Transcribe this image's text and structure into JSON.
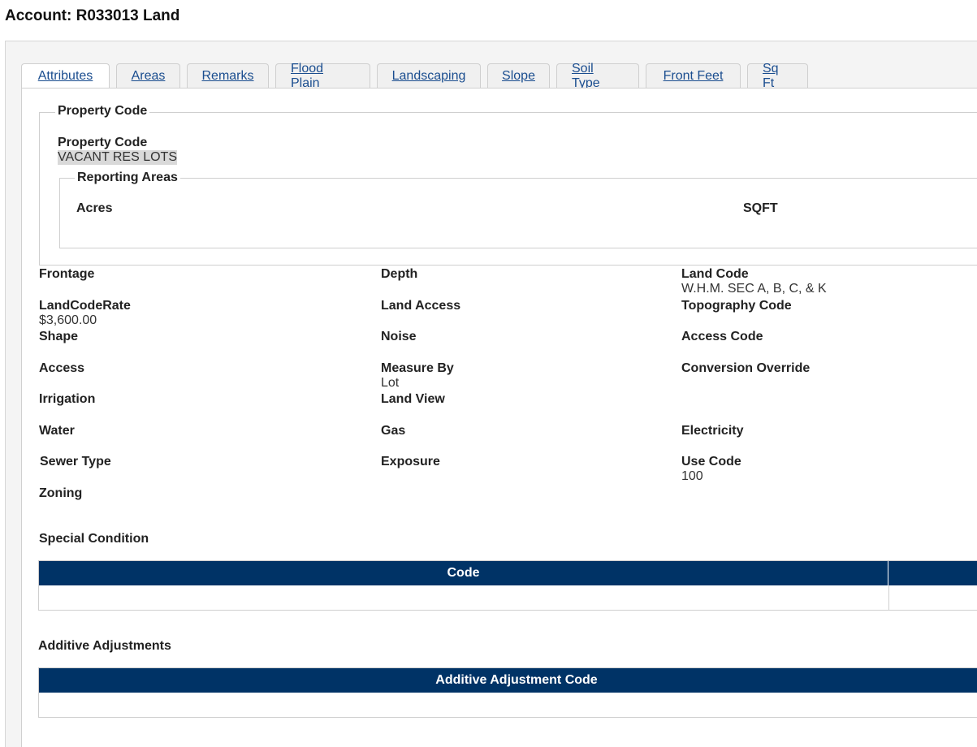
{
  "page": {
    "title": "Account: R033013 Land"
  },
  "tabs": [
    {
      "label": "Attributes",
      "active": true
    },
    {
      "label": "Areas",
      "active": false
    },
    {
      "label": "Remarks",
      "active": false
    },
    {
      "label": "Flood Plain",
      "active": false
    },
    {
      "label": "Landscaping",
      "active": false
    },
    {
      "label": "Slope",
      "active": false
    },
    {
      "label": "Soil Type",
      "active": false
    },
    {
      "label": "Front Feet",
      "active": false
    },
    {
      "label": "Sq Ft",
      "active": false
    }
  ],
  "property_code": {
    "legend": "Property Code",
    "label": "Property Code",
    "value": "VACANT RES LOTS"
  },
  "reporting_areas": {
    "legend": "Reporting Areas",
    "acres_label": "Acres",
    "sqft_label": "SQFT"
  },
  "fields": {
    "frontage": {
      "label": "Frontage",
      "value": ""
    },
    "depth": {
      "label": "Depth",
      "value": ""
    },
    "land_code": {
      "label": "Land Code",
      "value": "W.H.M. SEC A, B, C, & K"
    },
    "land_code_rate": {
      "label": "LandCodeRate",
      "value": "$3,600.00"
    },
    "land_access": {
      "label": "Land Access",
      "value": ""
    },
    "topography_code": {
      "label": "Topography Code",
      "value": ""
    },
    "shape": {
      "label": "Shape",
      "value": ""
    },
    "noise": {
      "label": "Noise",
      "value": ""
    },
    "access_code": {
      "label": "Access Code",
      "value": ""
    },
    "access": {
      "label": "Access",
      "value": ""
    },
    "measure_by": {
      "label": "Measure By",
      "value": "Lot"
    },
    "conversion_override": {
      "label": "Conversion Override",
      "value": ""
    },
    "irrigation": {
      "label": "Irrigation",
      "value": ""
    },
    "land_view": {
      "label": "Land View",
      "value": ""
    },
    "water": {
      "label": "Water",
      "value": ""
    },
    "gas": {
      "label": "Gas",
      "value": ""
    },
    "electricity": {
      "label": "Electricity",
      "value": ""
    },
    "sewer_type": {
      "label": "Sewer Type",
      "value": ""
    },
    "exposure": {
      "label": "Exposure",
      "value": ""
    },
    "use_code": {
      "label": "Use Code",
      "value": "100"
    },
    "zoning": {
      "label": "Zoning",
      "value": ""
    }
  },
  "special_condition": {
    "heading": "Special Condition",
    "columns": [
      "Code",
      ""
    ]
  },
  "additive_adjustments": {
    "heading": "Additive Adjustments",
    "columns": [
      "Additive Adjustment Code"
    ]
  },
  "colors": {
    "table_header": "#003366",
    "tab_link": "#1a4d8f",
    "highlight": "#d9d9d9"
  }
}
